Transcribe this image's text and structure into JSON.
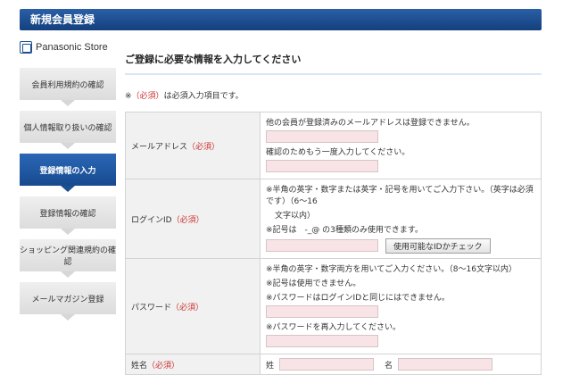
{
  "header": {
    "title": "新規会員登録"
  },
  "brand": {
    "name": "Panasonic Store"
  },
  "steps": [
    {
      "label": "会員利用規約の確認"
    },
    {
      "label": "個人情報取り扱いの確認"
    },
    {
      "label": "登録情報の入力",
      "active": true
    },
    {
      "label": "登録情報の確認"
    },
    {
      "label": "ショッピング関連規約の確認"
    },
    {
      "label": "メールマガジン登録"
    }
  ],
  "main": {
    "heading": "ご登録に必要な情報を入力してください",
    "note_prefix": "※",
    "note_required": "（必須）",
    "note_suffix": "は必須入力項目です。",
    "required_mark": "（必須）",
    "email": {
      "label": "メールアドレス",
      "hint1": "他の会員が登録済みのメールアドレスは登録できません。",
      "hint2": "確認のためもう一度入力してください。",
      "value": "",
      "confirm_value": ""
    },
    "login": {
      "label": "ログインID",
      "hint1": "※半角の英字・数字または英字・記号を用いてご入力下さい。（英字は必須です）（6～16",
      "hint1b": "文字以内）",
      "hint2": "※記号は　-_@ の3種類のみ使用できます。",
      "value": "",
      "check_button": "使用可能なIDかチェック"
    },
    "password": {
      "label": "パスワード",
      "hint1": "※半角の英字・数字両方を用いてご入力ください。（8～16文字以内）",
      "hint2": "※記号は使用できません。",
      "hint3": "※パスワードはログインIDと同じにはできません。",
      "hint4": "※パスワードを再入力してください。",
      "value": "",
      "confirm_value": ""
    },
    "name": {
      "label": "姓名",
      "last_label": "姓",
      "first_label": "名",
      "last_value": "",
      "first_value": ""
    }
  }
}
